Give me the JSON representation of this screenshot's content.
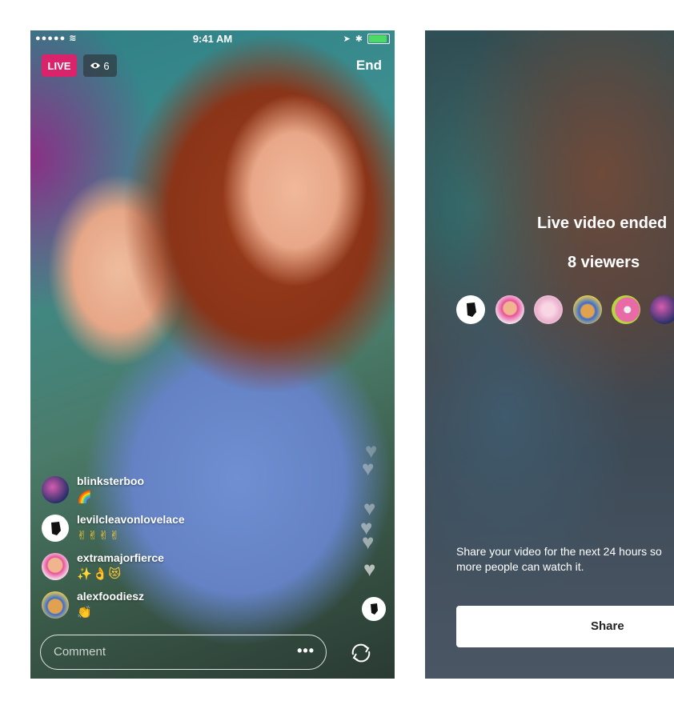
{
  "left_screen": {
    "status_bar": {
      "signal": "●●●●● ≋",
      "time": "9:41 AM"
    },
    "live_label": "LIVE",
    "viewer_count": "6",
    "end_label": "End",
    "comments": [
      {
        "username": "blinksterboo",
        "text": "🌈"
      },
      {
        "username": "levilcleavonlovelace",
        "text": "✌✌✌✌"
      },
      {
        "username": "extramajorfierce",
        "text": "✨👌😻"
      },
      {
        "username": "alexfoodiesz",
        "text": "👏"
      }
    ],
    "comment_placeholder": "Comment",
    "more_label": "•••"
  },
  "right_screen": {
    "title": "Live video ended",
    "viewers": "8 viewers",
    "share_text": "Share your video for the next 24 hours so more people can watch it.",
    "share_button": "Share"
  },
  "colors": {
    "live": "#d9236a",
    "battery": "#4cd964",
    "emoji_yellow": "#ffcc33"
  }
}
